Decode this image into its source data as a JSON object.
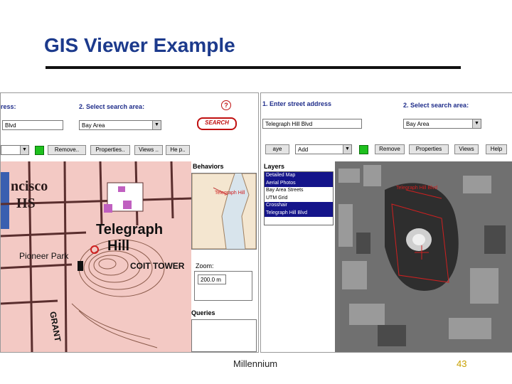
{
  "slide": {
    "title": "GIS Viewer Example",
    "footer_center": "Millennium",
    "page_number": "43"
  },
  "left_window": {
    "address_label": "ress:",
    "address_value": "Blvd",
    "search_area_label": "2. Select search area:",
    "search_area_value": "Bay Area",
    "search_button": "SEARCH",
    "help_icon": "?",
    "toolbar": {
      "remove": "Remove..",
      "properties": "Properties..",
      "views": "Views ..",
      "help": "He p.."
    },
    "behaviors_label": "Behaviors",
    "map_labels": {
      "district": "ncisco",
      "district2": "HS",
      "telegraph": "Telegraph",
      "hill": "Hill",
      "pioneer": "Pioneer Park",
      "coit": "COIT TOWER",
      "grant": "GRANT"
    },
    "overview_label": "Telegraph Hill",
    "zoom_label": "Zoom:",
    "zoom_value": "200.0 m",
    "queries_label": "Queries"
  },
  "right_window": {
    "address_label": "1. Enter street address",
    "address_value": "Telegraph Hill Blvd",
    "search_area_label": "2. Select search area:",
    "search_area_value": "Bay Area",
    "toolbar": {
      "first": "aye",
      "add_select": "Add",
      "remove": "Remove",
      "properties": "Properties",
      "views": "Views",
      "help": "Help"
    },
    "layers_label": "Layers",
    "layers": [
      {
        "label": "Detailed Map",
        "selected": true
      },
      {
        "label": "Aerial Photos",
        "selected": true
      },
      {
        "label": "Bay Area Streets",
        "selected": false
      },
      {
        "label": "UTM Grid",
        "selected": false
      },
      {
        "label": "Crosshair",
        "selected": true
      },
      {
        "label": "Telegraph Hill Blvd",
        "selected": true
      }
    ],
    "aerial_label": "Telegraph Hill Blvd"
  },
  "colors": {
    "title": "#1c3a8c",
    "map_background": "#f3c9c4",
    "street_lines": "#5a2e2e",
    "selection": "#14148a",
    "accent_red": "#d02020",
    "green_button": "#1ec01e",
    "page_number": "#c8a000"
  }
}
